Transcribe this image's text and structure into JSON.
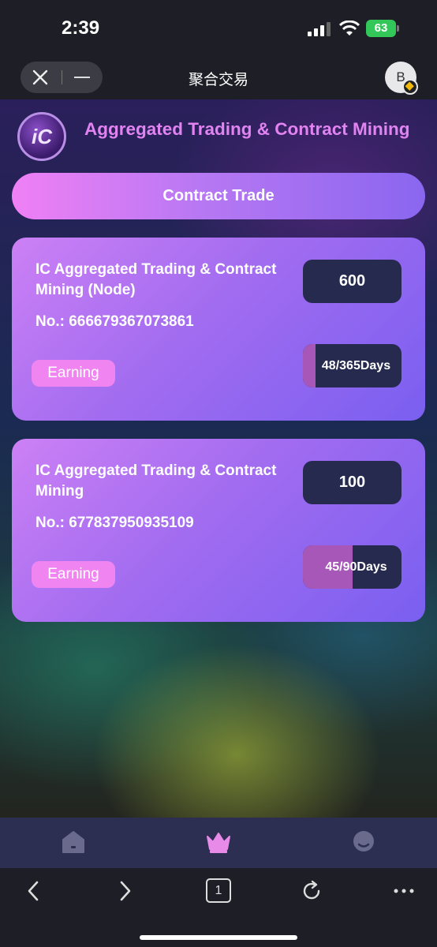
{
  "status_bar": {
    "time": "2:39",
    "battery": "63"
  },
  "nav": {
    "title": "聚合交易",
    "avatar_letter": "B"
  },
  "header": {
    "logo_text": "iC",
    "title": "Aggregated Trading & Contract Mining"
  },
  "contract_button": {
    "label": "Contract Trade"
  },
  "cards": [
    {
      "title": "IC Aggregated Trading & Contract Mining (Node)",
      "number": "No.: 666679367073861",
      "amount": "600",
      "status": "Earning",
      "progress_text": "48/365Days",
      "progress": 0.13
    },
    {
      "title": "IC Aggregated Trading & Contract Mining",
      "number": "No.: 677837950935109",
      "amount": "100",
      "status": "Earning",
      "progress_text": "45/90Days",
      "progress": 0.5
    }
  ],
  "tab_bar": {
    "active": 1,
    "items": [
      {
        "icon": "home-icon"
      },
      {
        "icon": "crown-icon"
      },
      {
        "icon": "profile-icon"
      }
    ]
  },
  "browser": {
    "tabs_count": "1"
  },
  "colors": {
    "accent_pink": "#f084f0",
    "card_gradient_start": "#cc80f5",
    "card_gradient_end": "#7a5ff0",
    "dark_box": "#262a4e",
    "title_pink": "#e184f2"
  }
}
